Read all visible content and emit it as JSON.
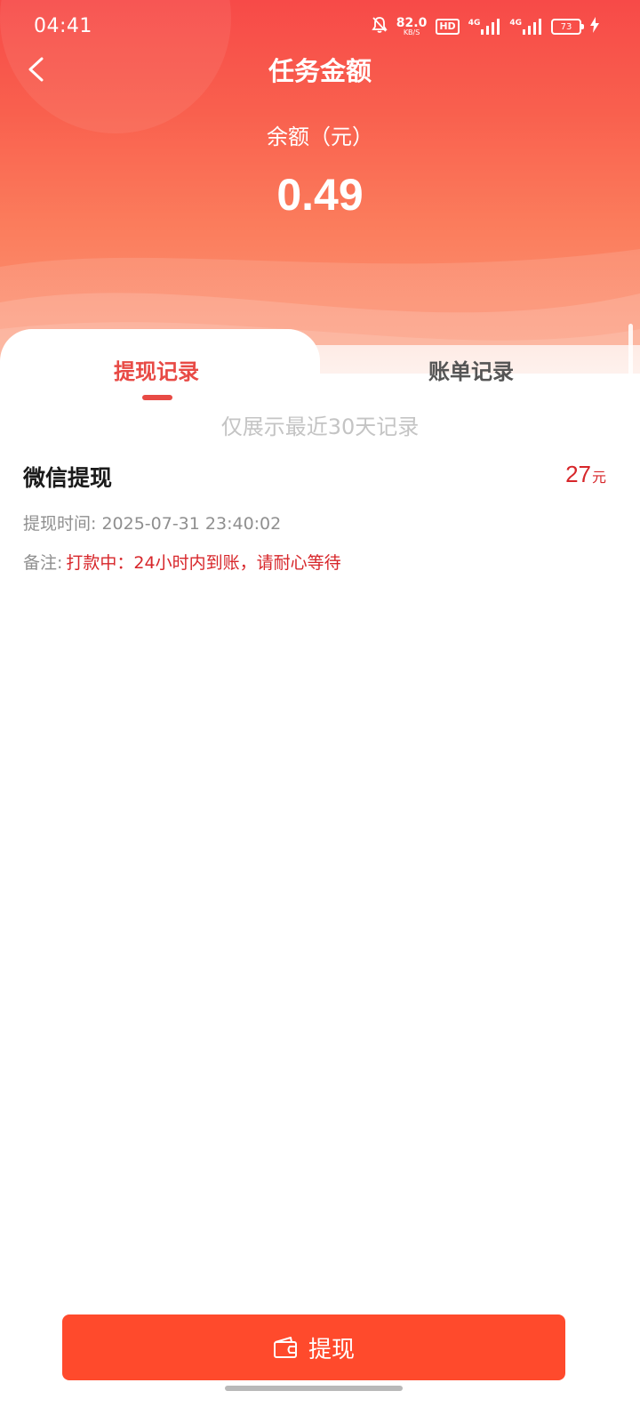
{
  "status_bar": {
    "time": "04:41",
    "net_speed": "82.0",
    "net_unit": "KB/S",
    "hd_label": "HD",
    "signal_1_label": "4G",
    "signal_2_label": "4G",
    "battery_level": "73",
    "icons": [
      "bell-muted-icon",
      "hd-icon",
      "signal-4g-icon",
      "signal-4g-icon",
      "battery-icon",
      "charging-icon"
    ]
  },
  "header": {
    "title": "任务金额",
    "balance_label": "余额（元）",
    "balance_value": "0.49",
    "back_icon": "chevron-left-icon"
  },
  "tabs": {
    "items": [
      {
        "label": "提现记录",
        "active": true
      },
      {
        "label": "账单记录",
        "active": false
      }
    ],
    "note": "仅展示最近30天记录"
  },
  "records": [
    {
      "title": "微信提现",
      "amount": "27",
      "amount_unit": "元",
      "time_label": "提现时间: 2025-07-31 23:40:02",
      "note_label": "备注:",
      "note_text": "打款中：24小时内到账，请耐心等待"
    }
  ],
  "footer": {
    "withdraw_label": "提现",
    "withdraw_icon": "wallet-icon"
  },
  "colors": {
    "accent": "#e84a45",
    "button": "#ff4a2c",
    "amount": "#d7262a",
    "header_top": "#f74a48",
    "header_bottom": "#fc9a7a"
  }
}
